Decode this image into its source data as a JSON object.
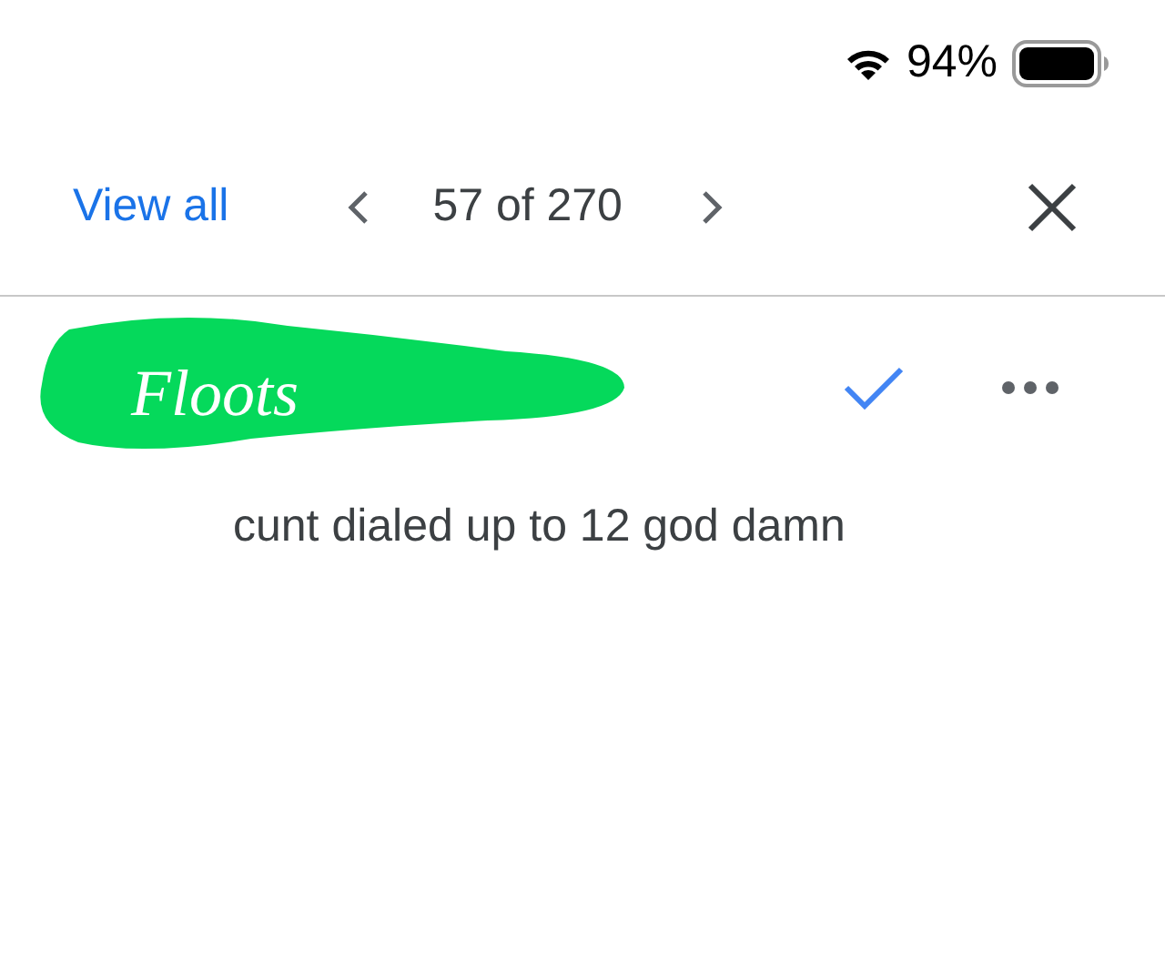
{
  "status_bar": {
    "battery": "94%"
  },
  "toolbar": {
    "view_all": "View all",
    "counter": "57 of 270"
  },
  "comment": {
    "author": "Floots",
    "text": "cunt dialed up to 12 god damn"
  }
}
